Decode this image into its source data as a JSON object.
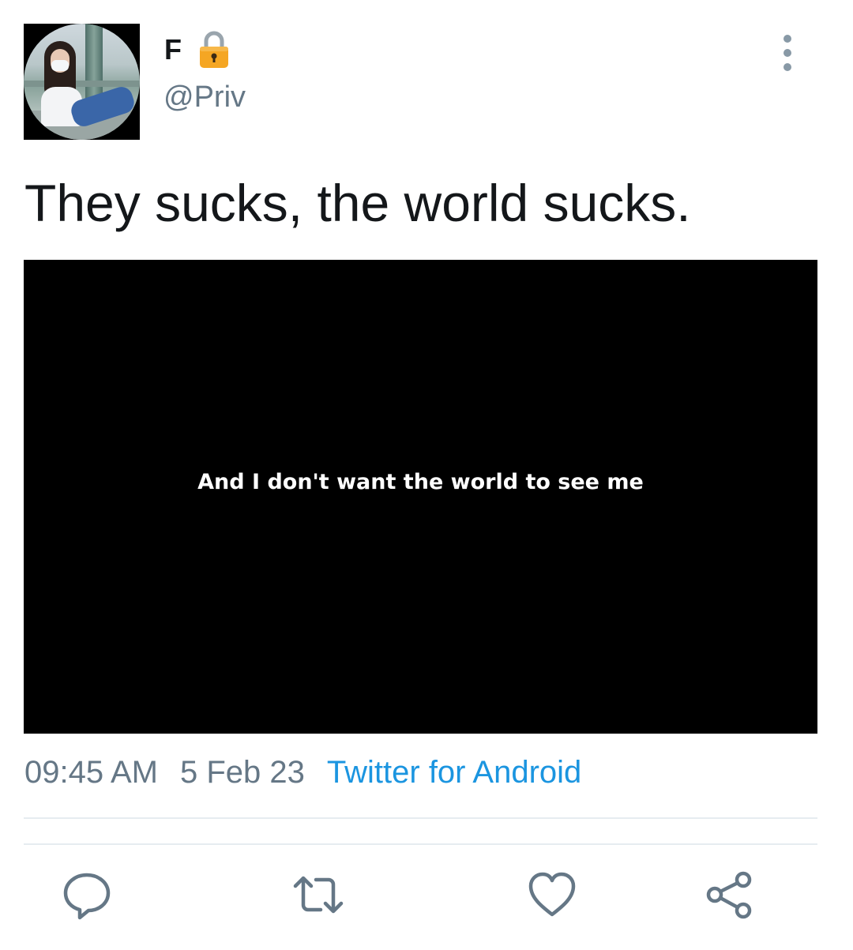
{
  "user": {
    "name": "F",
    "handle": "@Priv",
    "avatar_alt": "profile-photo",
    "lock_icon": "lock-icon"
  },
  "tweet": {
    "text": "They sucks, the world sucks.",
    "media_caption": "And I don't want the world to see me",
    "time": "09:45 AM",
    "date": "5 Feb 23",
    "source": "Twitter for Android"
  },
  "colors": {
    "primary_text": "#14171a",
    "secondary_text": "#657786",
    "link": "#1b95e0",
    "icon": "#657786",
    "divider": "#e6ecf0",
    "lock_body": "#f5a623"
  },
  "actions": [
    {
      "icon": "reply-icon"
    },
    {
      "icon": "retweet-icon"
    },
    {
      "icon": "like-icon"
    },
    {
      "icon": "share-icon"
    }
  ]
}
